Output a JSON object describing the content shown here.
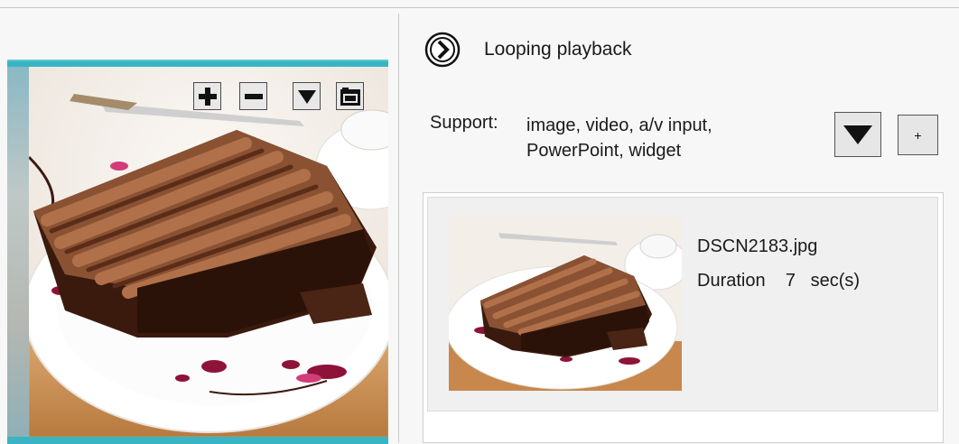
{
  "tile_toolbar": {
    "zoom_in_icon": "plus-icon",
    "zoom_out_icon": "minus-icon",
    "menu_icon": "triangle-down-icon",
    "folder_icon": "folder-icon"
  },
  "playback": {
    "icon": "chevron-right-circle-icon",
    "label": "Looping playback"
  },
  "support": {
    "label": "Support:",
    "types_line1": "image, video, a/v input,",
    "types_line2": "PowerPoint, widget"
  },
  "controls": {
    "dropdown_icon": "triangle-down-icon",
    "add_label": "+"
  },
  "media_items": [
    {
      "file_name": "DSCN2183.jpg",
      "duration_label": "Duration",
      "duration_value": "7",
      "duration_unit": "sec(s)"
    }
  ],
  "colors": {
    "accent_frame": "#39b4c4",
    "background": "#f7f7f7",
    "selected_item": "#f0f0f0"
  }
}
